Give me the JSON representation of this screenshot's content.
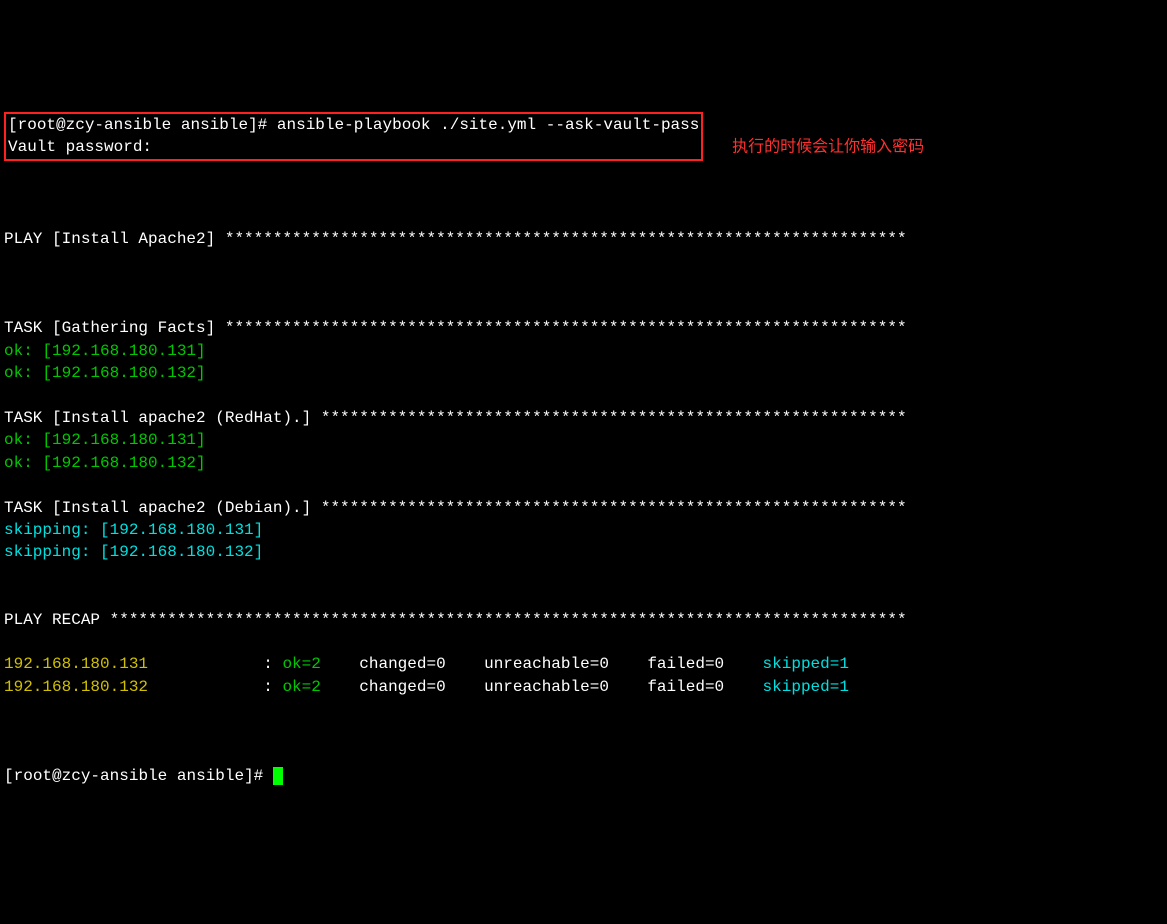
{
  "prompt": {
    "user": "root",
    "host": "zcy-ansible",
    "dir": "ansible",
    "cmd": "ansible-playbook ./site.yml --ask-vault-pass",
    "vault_label": "Vault password:"
  },
  "annotation": "执行的时候会让你输入密码",
  "play_header": "PLAY [Install Apache2] ",
  "tasks": [
    {
      "header": "TASK [Gathering Facts] ",
      "results": [
        {
          "status": "ok",
          "host": "192.168.180.131"
        },
        {
          "status": "ok",
          "host": "192.168.180.132"
        }
      ]
    },
    {
      "header": "TASK [Install apache2 (RedHat).] ",
      "results": [
        {
          "status": "ok",
          "host": "192.168.180.131"
        },
        {
          "status": "ok",
          "host": "192.168.180.132"
        }
      ]
    },
    {
      "header": "TASK [Install apache2 (Debian).] ",
      "results": [
        {
          "status": "skipping",
          "host": "192.168.180.131"
        },
        {
          "status": "skipping",
          "host": "192.168.180.132"
        }
      ]
    }
  ],
  "recap_header": "PLAY RECAP ",
  "recap": [
    {
      "host": "192.168.180.131",
      "ok": "2",
      "changed": "0",
      "unreachable": "0",
      "failed": "0",
      "skipped": "1"
    },
    {
      "host": "192.168.180.132",
      "ok": "2",
      "changed": "0",
      "unreachable": "0",
      "failed": "0",
      "skipped": "1"
    }
  ],
  "labels": {
    "ok": "ok=",
    "changed": "changed=",
    "unreachable": "unreachable=",
    "failed": "failed=",
    "skipped": "skipped="
  }
}
